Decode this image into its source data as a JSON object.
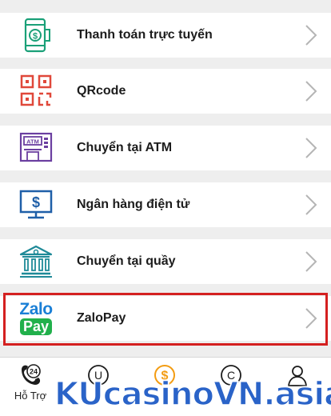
{
  "menu": {
    "items": [
      {
        "label": "Thanh toán trực tuyến",
        "icon": "mobile-payment-icon"
      },
      {
        "label": "QRcode",
        "icon": "qrcode-icon"
      },
      {
        "label": "Chuyển tại ATM",
        "icon": "atm-icon"
      },
      {
        "label": "Ngân hàng điện tử",
        "icon": "monitor-dollar-icon"
      },
      {
        "label": "Chuyển tại quầy",
        "icon": "bank-building-icon"
      },
      {
        "label": "ZaloPay",
        "icon": "zalopay-logo",
        "logo_text": [
          "Zalo",
          "Pay"
        ]
      }
    ]
  },
  "tabbar": {
    "items": [
      {
        "label": "Hỗ Trợ",
        "icon": "support-24-icon",
        "badge": "24"
      },
      {
        "label": "",
        "icon": "u-circle-icon",
        "badge": "U"
      },
      {
        "label": "",
        "icon": "dollar-circle-icon",
        "badge": "$"
      },
      {
        "label": "",
        "icon": "c-circle-icon",
        "badge": "C"
      },
      {
        "label": "",
        "icon": "user-icon"
      }
    ]
  },
  "watermark": "KUcasinoVN.asia",
  "colors": {
    "green": "#1aa078",
    "red": "#e0483a",
    "purple": "#6b3fa0",
    "blue": "#1f5fa8",
    "teal": "#1f8a98",
    "orange": "#f39c12",
    "highlight": "#d42020"
  }
}
